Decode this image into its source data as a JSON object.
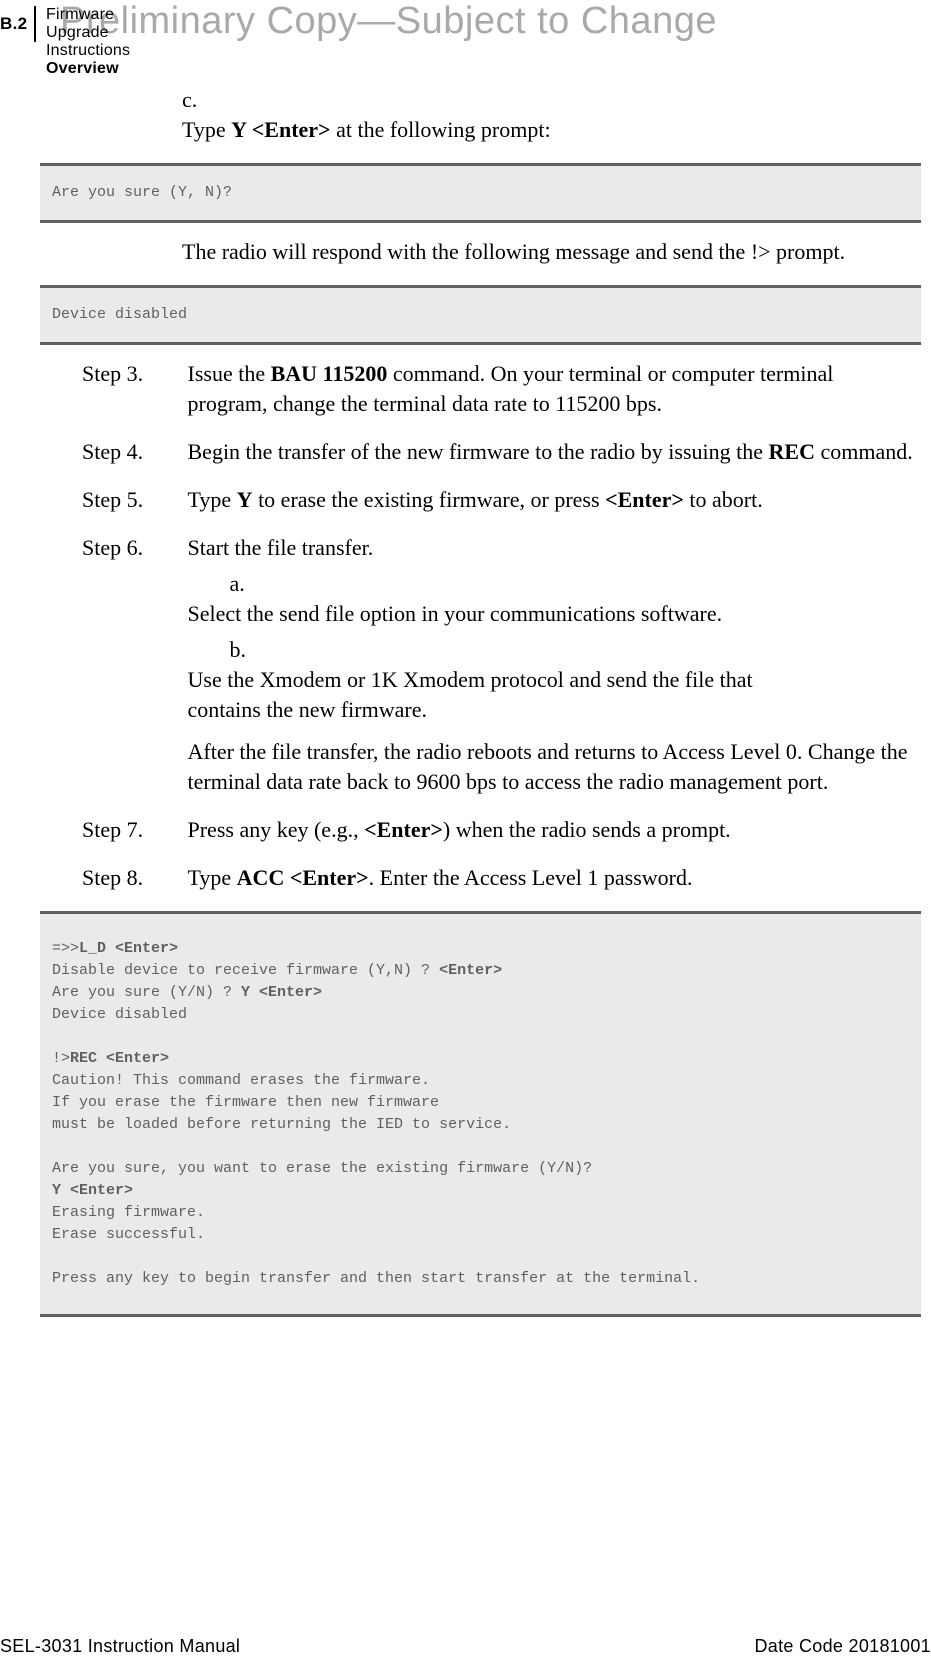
{
  "header": {
    "page_num": "B.2",
    "title1": "Firmware Upgrade Instructions",
    "title2": "Overview",
    "watermark": "Preliminary Copy—Subject to Change"
  },
  "sub_c": {
    "letter": "c.",
    "prefix": "Type ",
    "bold": "Y <Enter>",
    "suffix": " at the following prompt:"
  },
  "code1": "Are you sure (Y, N)?",
  "para1": "The radio will respond with the following message and send the !> prompt.",
  "code2": "Device disabled",
  "step3": {
    "label": "Step 3.",
    "text1": "Issue the ",
    "bold1": "BAU 115200",
    "text2": " command. On your terminal or computer terminal program, change the terminal data rate to 115200 bps."
  },
  "step4": {
    "label": "Step 4.",
    "text1": "Begin the transfer of the new firmware to the radio by issuing the ",
    "bold1": "REC",
    "text2": " command."
  },
  "step5": {
    "label": "Step 5.",
    "text1": "Type ",
    "bold1": "Y",
    "text2": " to erase the existing firmware, or press ",
    "bold2": "<Enter>",
    "text3": " to abort."
  },
  "step6": {
    "label": "Step 6.",
    "text1": "Start the file transfer.",
    "sub_a": {
      "letter": "a.",
      "text": "Select the send file option in your communications software."
    },
    "sub_b": {
      "letter": "b.",
      "text": "Use the Xmodem or 1K Xmodem protocol and send the file that contains the new firmware."
    },
    "after": "After the file transfer, the radio reboots and returns to Access Level 0. Change the terminal data rate back to 9600 bps to access the radio management port."
  },
  "step7": {
    "label": "Step 7.",
    "text1": "Press any key (e.g., ",
    "bold1": "<Enter>",
    "text2": ") when the radio sends a prompt."
  },
  "step8": {
    "label": "Step 8.",
    "text1": "Type ",
    "bold1": "ACC <Enter>",
    "text2": ". Enter the Access Level 1 password."
  },
  "code3": {
    "p1": "=>>",
    "b1": "L_D <Enter>",
    "l2a": "Disable device to receive firmware (Y,N) ? ",
    "b2": "<Enter>",
    "l3a": "Are you sure (Y/N) ? ",
    "b3": "Y <Enter>",
    "l4": "Device disabled",
    "l5a": "!>",
    "b5": "REC <Enter>",
    "l6": "Caution! This command erases the firmware.",
    "l7": "If you erase the firmware then new firmware",
    "l8": "must be loaded before returning the IED to service.",
    "l9": "Are you sure, you want to erase the existing firmware (Y/N)?",
    "b10": "Y <Enter>",
    "l11": "Erasing firmware.",
    "l12": "Erase successful.",
    "l13": "Press any key to begin transfer and then start transfer at the terminal."
  },
  "footer": {
    "left": "SEL-3031 Instruction Manual",
    "right": "Date Code 20181001"
  }
}
